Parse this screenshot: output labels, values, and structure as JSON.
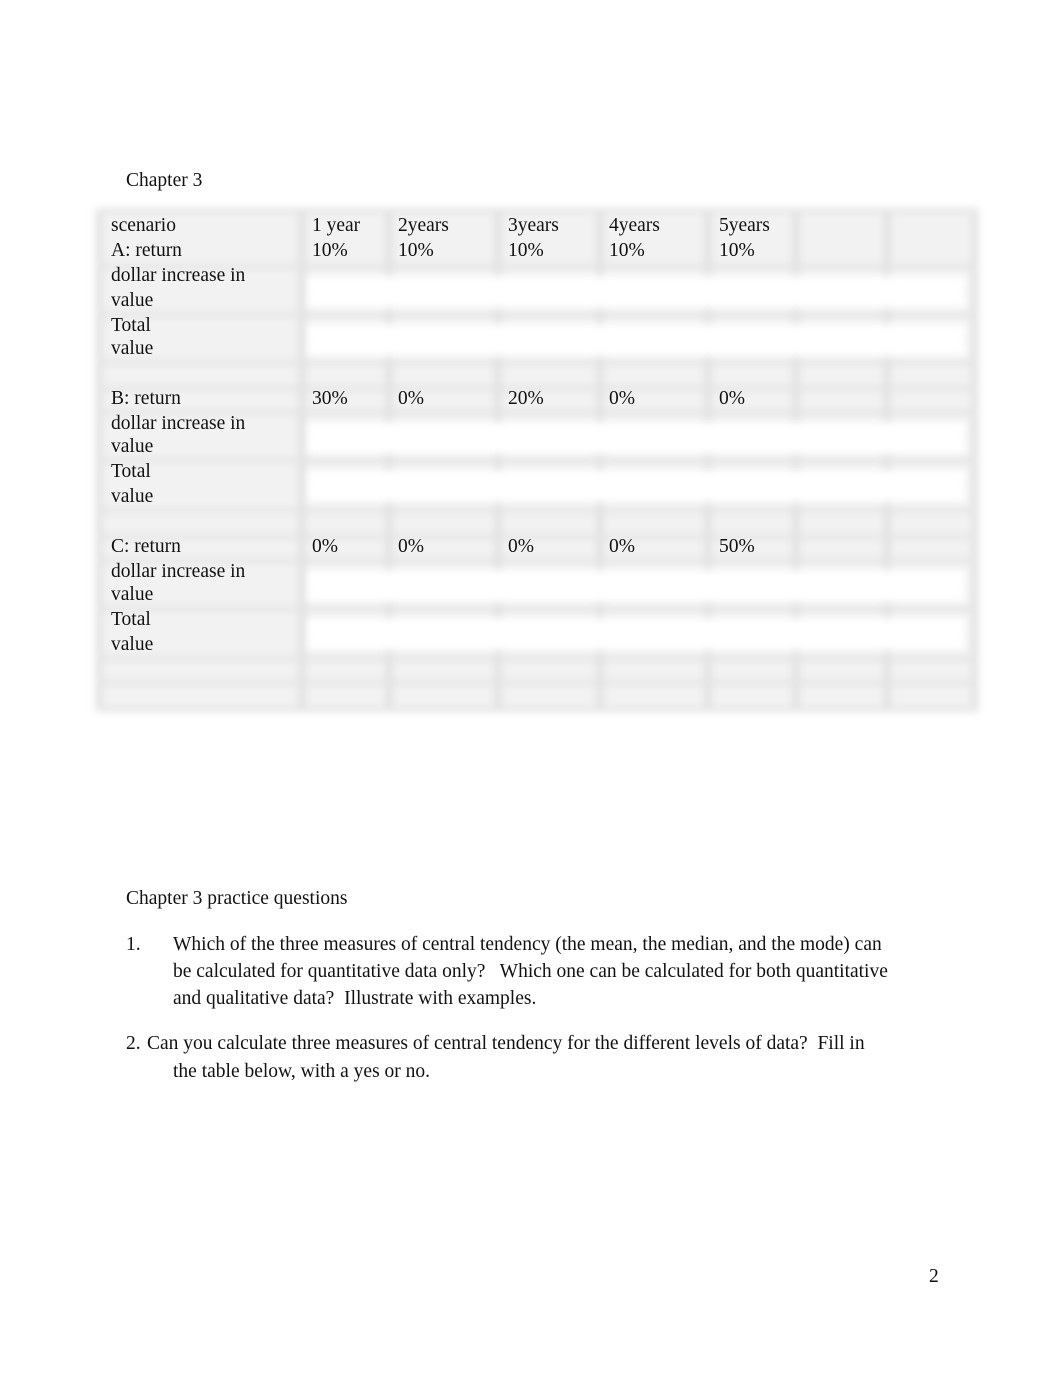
{
  "document": {
    "section_title": "Chapter 3",
    "page_number": "2"
  },
  "table": {
    "header": {
      "label": "scenario",
      "years": [
        "1 year",
        "2years",
        "3years",
        "4years",
        "5years"
      ]
    },
    "scenarios": [
      {
        "return_label": "A: return",
        "returns": [
          "10%",
          "10%",
          "10%",
          "10%",
          "10%"
        ],
        "dollar_label_line1": "dollar increase in",
        "dollar_label_line2": "value",
        "total_label_line1": "Total",
        "total_label_line2": "value"
      },
      {
        "return_label": "B: return",
        "returns": [
          "30%",
          "0%",
          "20%",
          "0%",
          "0%"
        ],
        "dollar_label_line1": "dollar increase in",
        "dollar_label_line2": "value",
        "total_label_line1": "Total",
        "total_label_line2": "value"
      },
      {
        "return_label": "C: return",
        "returns": [
          "0%",
          "0%",
          "0%",
          "0%",
          "50%"
        ],
        "dollar_label_line1": "dollar increase in",
        "dollar_label_line2": "value",
        "total_label_line1": "Total",
        "total_label_line2": "value"
      }
    ]
  },
  "practice": {
    "title": "Chapter 3 practice questions",
    "questions": [
      {
        "number": "1.",
        "lines": [
          "Which of the three measures of central tendency (the mean, the median, and the mode) can",
          "be calculated for quantitative data only?   Which one can be calculated for both quantitative",
          "and qualitative data?  Illustrate with examples."
        ]
      },
      {
        "number": "2.",
        "lines": [
          "Can you calculate three measures of central tendency for the different levels of data?  Fill in",
          "the table below, with a yes or no."
        ]
      }
    ]
  }
}
